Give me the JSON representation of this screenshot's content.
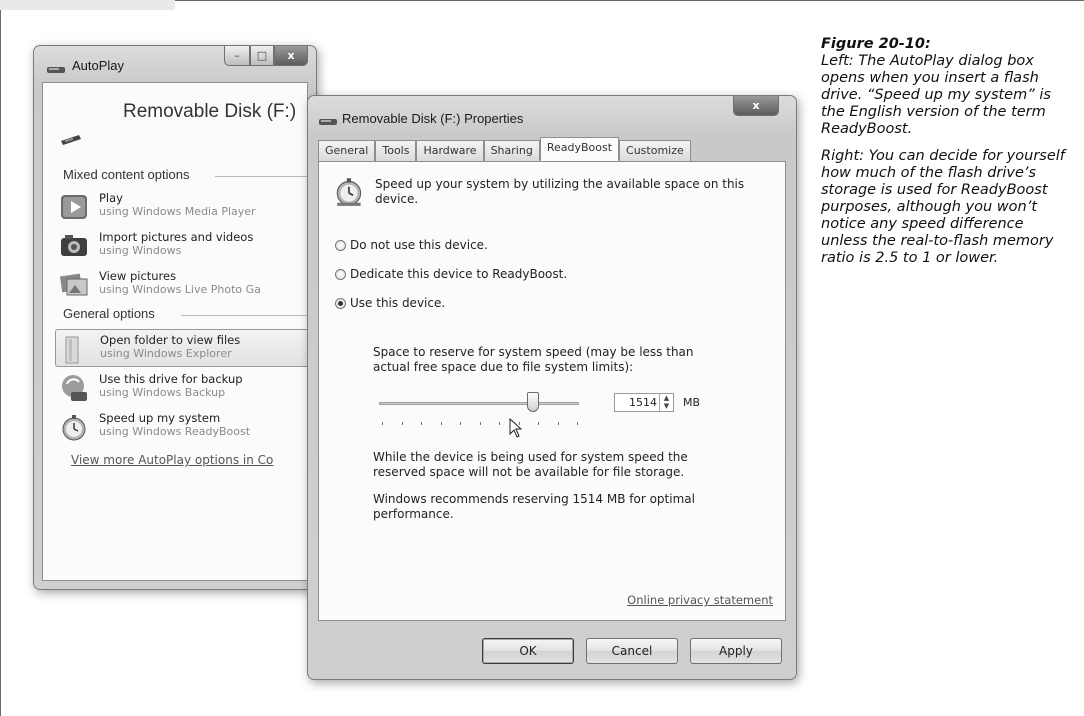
{
  "autoplay": {
    "title": "AutoPlay",
    "device_name": "Removable Disk (F:)",
    "mixed_header": "Mixed content options",
    "general_header": "General options",
    "mixed_items": [
      {
        "title": "Play",
        "subtitle": "using Windows Media Player",
        "icon": "play-icon"
      },
      {
        "title": "Import pictures and videos",
        "subtitle": "using Windows",
        "icon": "camera-icon"
      },
      {
        "title": "View pictures",
        "subtitle": "using Windows Live Photo Ga",
        "icon": "photo-gallery-icon"
      }
    ],
    "general_items": [
      {
        "title": "Open folder to view files",
        "subtitle": "using Windows Explorer",
        "icon": "folder-icon"
      },
      {
        "title": "Use this drive for backup",
        "subtitle": "using Windows Backup",
        "icon": "backup-icon"
      },
      {
        "title": "Speed up my system",
        "subtitle": "using Windows ReadyBoost",
        "icon": "stopwatch-icon"
      }
    ],
    "more_link": "View more AutoPlay options in Co"
  },
  "props": {
    "title": "Removable Disk (F:) Properties",
    "close_glyph": "x",
    "tabs": [
      "General",
      "Tools",
      "Hardware",
      "Sharing",
      "ReadyBoost",
      "Customize"
    ],
    "active_tab": "ReadyBoost",
    "intro": "Speed up your system by utilizing the available space on this device.",
    "options": {
      "do_not_use": "Do not use this device.",
      "dedicate": "Dedicate this device to ReadyBoost.",
      "use": "Use this device."
    },
    "selected_option": "use",
    "reserve_label": "Space to reserve for system speed (may be less than actual free space due to file system limits):",
    "slider_fraction": 0.77,
    "reserve_value": "1514",
    "unit": "MB",
    "note1": "While the device is being used for system speed the reserved space will not be available for file storage.",
    "note2": "Windows recommends reserving 1514 MB for optimal performance.",
    "privacy_link": "Online privacy statement",
    "buttons": {
      "ok": "OK",
      "cancel": "Cancel",
      "apply": "Apply"
    }
  },
  "caption": {
    "figure": "Figure 20-10:",
    "paragraph1": "Left: The AutoPlay dialog box opens when you insert a flash drive. “Speed up my system” is the English version of the term ReadyBoost.",
    "paragraph2": "Right: You can decide for yourself how much of the flash drive’s storage is used for ReadyBoost purposes, although you won’t notice any speed difference unless the real-to-flash memory ratio is 2.5 to 1 or lower."
  }
}
